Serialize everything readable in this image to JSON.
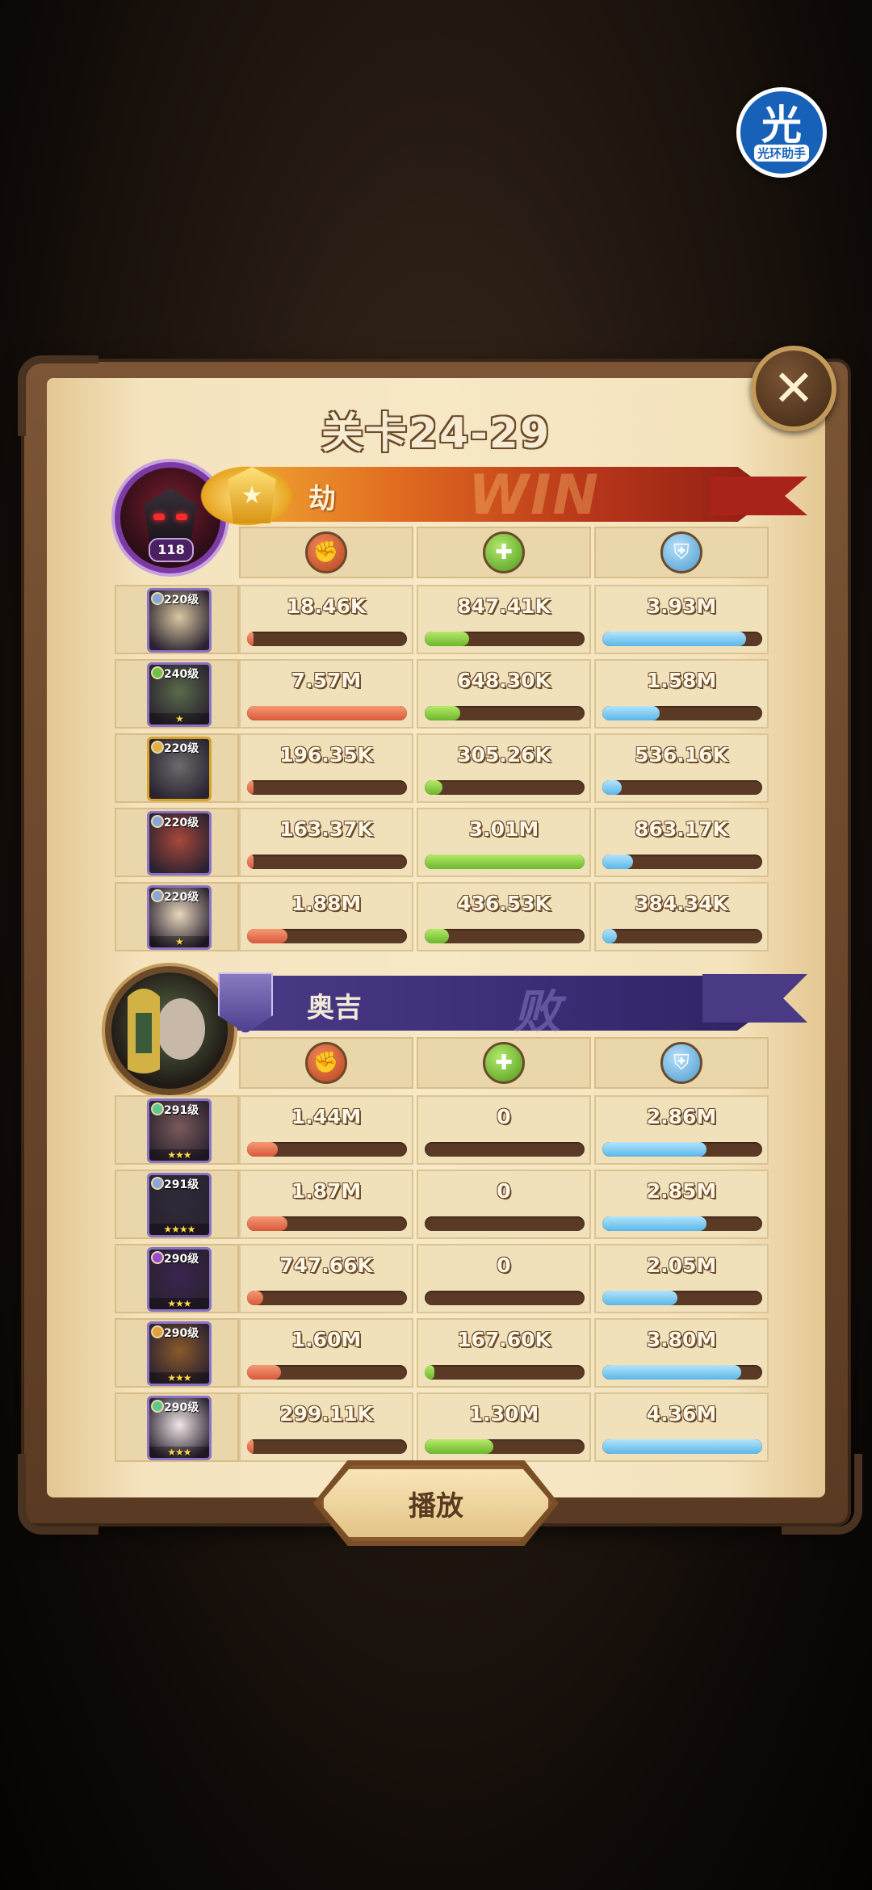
{
  "assistant_badge": {
    "glyph": "光",
    "label": "光环助手"
  },
  "stage_title": "关卡24-29",
  "close_icon": "close-icon",
  "winner": {
    "name": "劫",
    "result": "WIN",
    "level": "118",
    "banner_color": "#d9531e"
  },
  "loser": {
    "name": "奥吉",
    "result": "败",
    "banner_color": "#3a2c74"
  },
  "stat_icons": [
    "damage-icon",
    "heal-icon",
    "shield-icon"
  ],
  "colors": {
    "damage": "#e06a48",
    "heal": "#8ccc3f",
    "shield": "#6ec3ee"
  },
  "winner_heroes": [
    {
      "level": "220级",
      "stars": "",
      "frame": "purple",
      "faction": "#8aa6d8",
      "face": "#d9c7a0",
      "damage": "18.46K",
      "heal": "847.41K",
      "shield": "3.93M",
      "damage_pct": 0.01,
      "heal_pct": 0.28,
      "shield_pct": 0.9
    },
    {
      "level": "240级",
      "stars": "★",
      "frame": "purple",
      "faction": "#6cc24a",
      "face": "#5a6b4a",
      "damage": "7.57M",
      "heal": "648.30K",
      "shield": "1.58M",
      "damage_pct": 1.0,
      "heal_pct": 0.22,
      "shield_pct": 0.36
    },
    {
      "level": "220级",
      "stars": "",
      "frame": "gold",
      "faction": "#e3b048",
      "face": "#6b6b6b",
      "damage": "196.35K",
      "heal": "305.26K",
      "shield": "536.16K",
      "damage_pct": 0.03,
      "heal_pct": 0.11,
      "shield_pct": 0.12
    },
    {
      "level": "220级",
      "stars": "",
      "frame": "purple",
      "faction": "#8aa6d8",
      "face": "#a8483a",
      "damage": "163.37K",
      "heal": "3.01M",
      "shield": "863.17K",
      "damage_pct": 0.03,
      "heal_pct": 1.0,
      "shield_pct": 0.19
    },
    {
      "level": "220级",
      "stars": "★",
      "frame": "purple",
      "faction": "#8aa6d8",
      "face": "#e8d7bd",
      "damage": "1.88M",
      "heal": "436.53K",
      "shield": "384.34K",
      "damage_pct": 0.25,
      "heal_pct": 0.15,
      "shield_pct": 0.09
    }
  ],
  "loser_heroes": [
    {
      "level": "291级",
      "stars": "★★★",
      "frame": "purple",
      "faction": "#5cc98a",
      "face": "#7a5a5a",
      "damage": "1.44M",
      "heal": "0",
      "shield": "2.86M",
      "damage_pct": 0.19,
      "heal_pct": 0.0,
      "shield_pct": 0.65
    },
    {
      "level": "291级",
      "stars": "★★★★",
      "frame": "purple",
      "faction": "#8aa6d8",
      "face": "#2f2a3a",
      "damage": "1.87M",
      "heal": "0",
      "shield": "2.85M",
      "damage_pct": 0.25,
      "heal_pct": 0.0,
      "shield_pct": 0.65
    },
    {
      "level": "290级",
      "stars": "★★★",
      "frame": "purple",
      "faction": "#9a4ad0",
      "face": "#3a2450",
      "damage": "747.66K",
      "heal": "0",
      "shield": "2.05M",
      "damage_pct": 0.1,
      "heal_pct": 0.0,
      "shield_pct": 0.47
    },
    {
      "level": "290级",
      "stars": "★★★",
      "frame": "purple",
      "faction": "#e3a040",
      "face": "#8a5a2a",
      "damage": "1.60M",
      "heal": "167.60K",
      "shield": "3.80M",
      "damage_pct": 0.21,
      "heal_pct": 0.06,
      "shield_pct": 0.87
    },
    {
      "level": "290级",
      "stars": "★★★",
      "frame": "purple",
      "faction": "#5cc98a",
      "face": "#f0e6e6",
      "damage": "299.11K",
      "heal": "1.30M",
      "shield": "4.36M",
      "damage_pct": 0.04,
      "heal_pct": 0.43,
      "shield_pct": 1.0
    }
  ],
  "play_button_label": "播放"
}
